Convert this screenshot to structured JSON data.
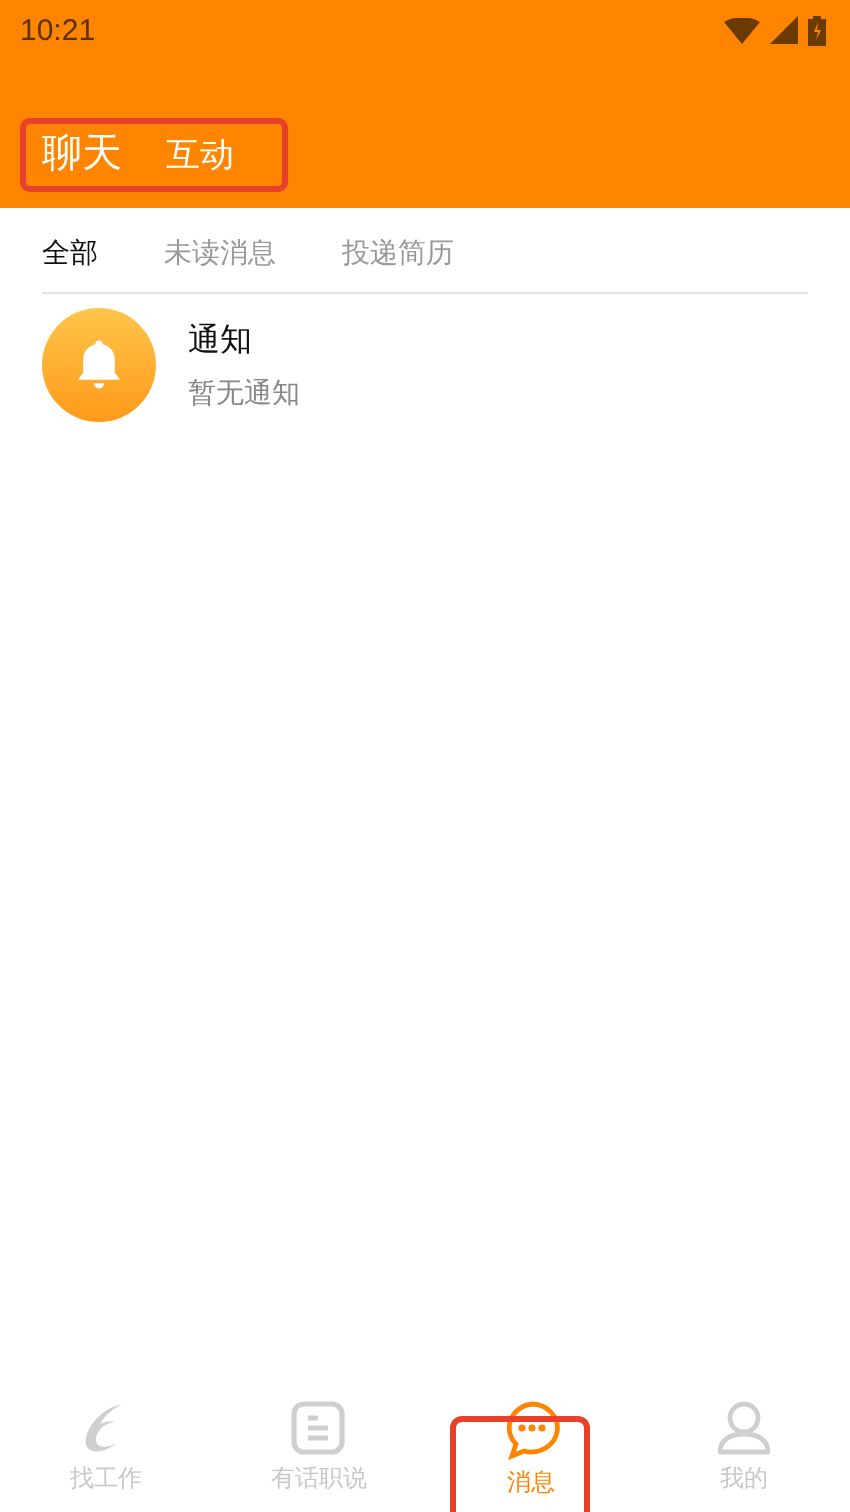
{
  "status_bar": {
    "time": "10:21"
  },
  "header": {
    "highlighted": true,
    "tabs": [
      {
        "label": "聊天",
        "selected": true
      },
      {
        "label": "互动",
        "selected": false
      }
    ]
  },
  "filter_tabs": [
    {
      "label": "全部",
      "selected": true
    },
    {
      "label": "未读消息",
      "selected": false
    },
    {
      "label": "投递简历",
      "selected": false
    }
  ],
  "conversations": [
    {
      "kind": "notice",
      "title": "通知",
      "preview": "暂无通知"
    }
  ],
  "bottom_nav": [
    {
      "kind": "jobs",
      "label": "找工作",
      "selected": false,
      "highlighted": false
    },
    {
      "kind": "posts",
      "label": "有话职说",
      "selected": false,
      "highlighted": false
    },
    {
      "kind": "messages",
      "label": "消息",
      "selected": true,
      "highlighted": true
    },
    {
      "kind": "profile",
      "label": "我的",
      "selected": false,
      "highlighted": false
    }
  ]
}
